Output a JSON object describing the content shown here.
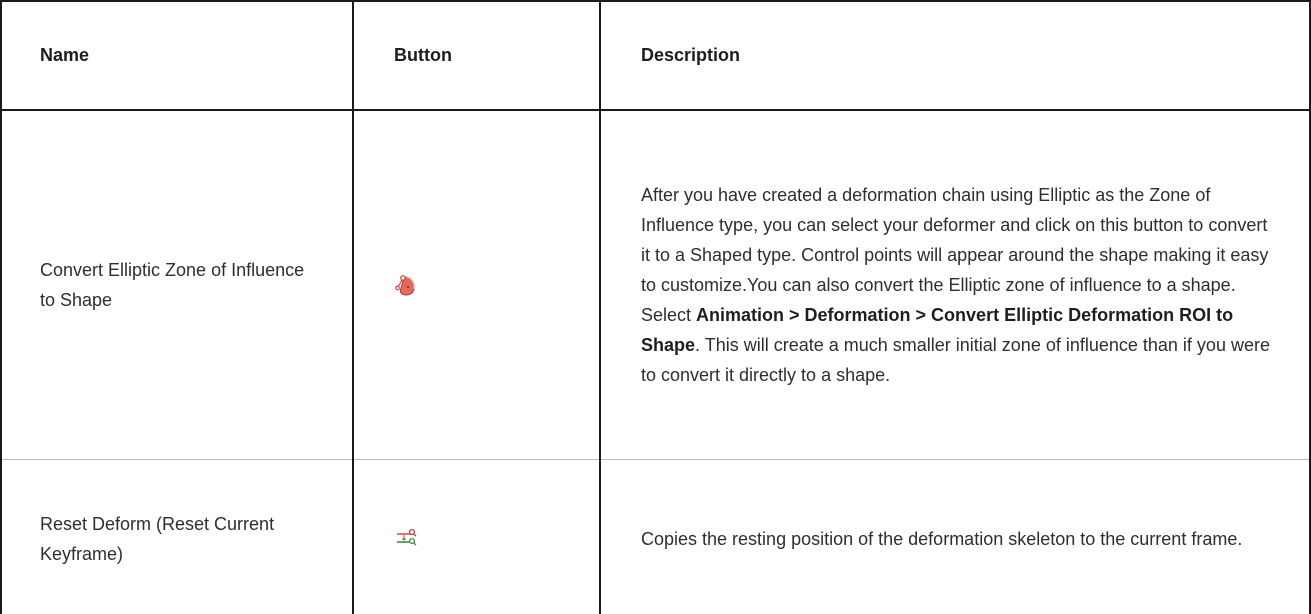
{
  "table": {
    "headers": {
      "name": "Name",
      "button": "Button",
      "description": "Description"
    },
    "rows": [
      {
        "name": "Convert Elliptic Zone of Influence to Shape",
        "icon": "convert-elliptic-zone-to-shape-icon",
        "description": {
          "part1": "After you have created a deformation chain using Elliptic as the Zone of Influence type, you can select your deformer and click on this button to convert it to a Shaped type. Control points will appear around the shape making it easy to customize.You can also convert the Elliptic zone of influence to a shape. Select ",
          "bold": "Animation > Deformation > Convert Elliptic Deformation ROI to Shape",
          "part2": ". This will create a much smaller initial zone of influence than if you were to convert it directly to a shape."
        }
      },
      {
        "name": "Reset Deform (Reset Current Keyframe)",
        "icon": "reset-deform-icon",
        "description": {
          "text": "Copies the resting position of the deformation skeleton to the current frame."
        }
      }
    ]
  },
  "colors": {
    "border": "#1a1a1a",
    "icon_red": "#d9534f",
    "icon_green": "#3c8c3c"
  }
}
